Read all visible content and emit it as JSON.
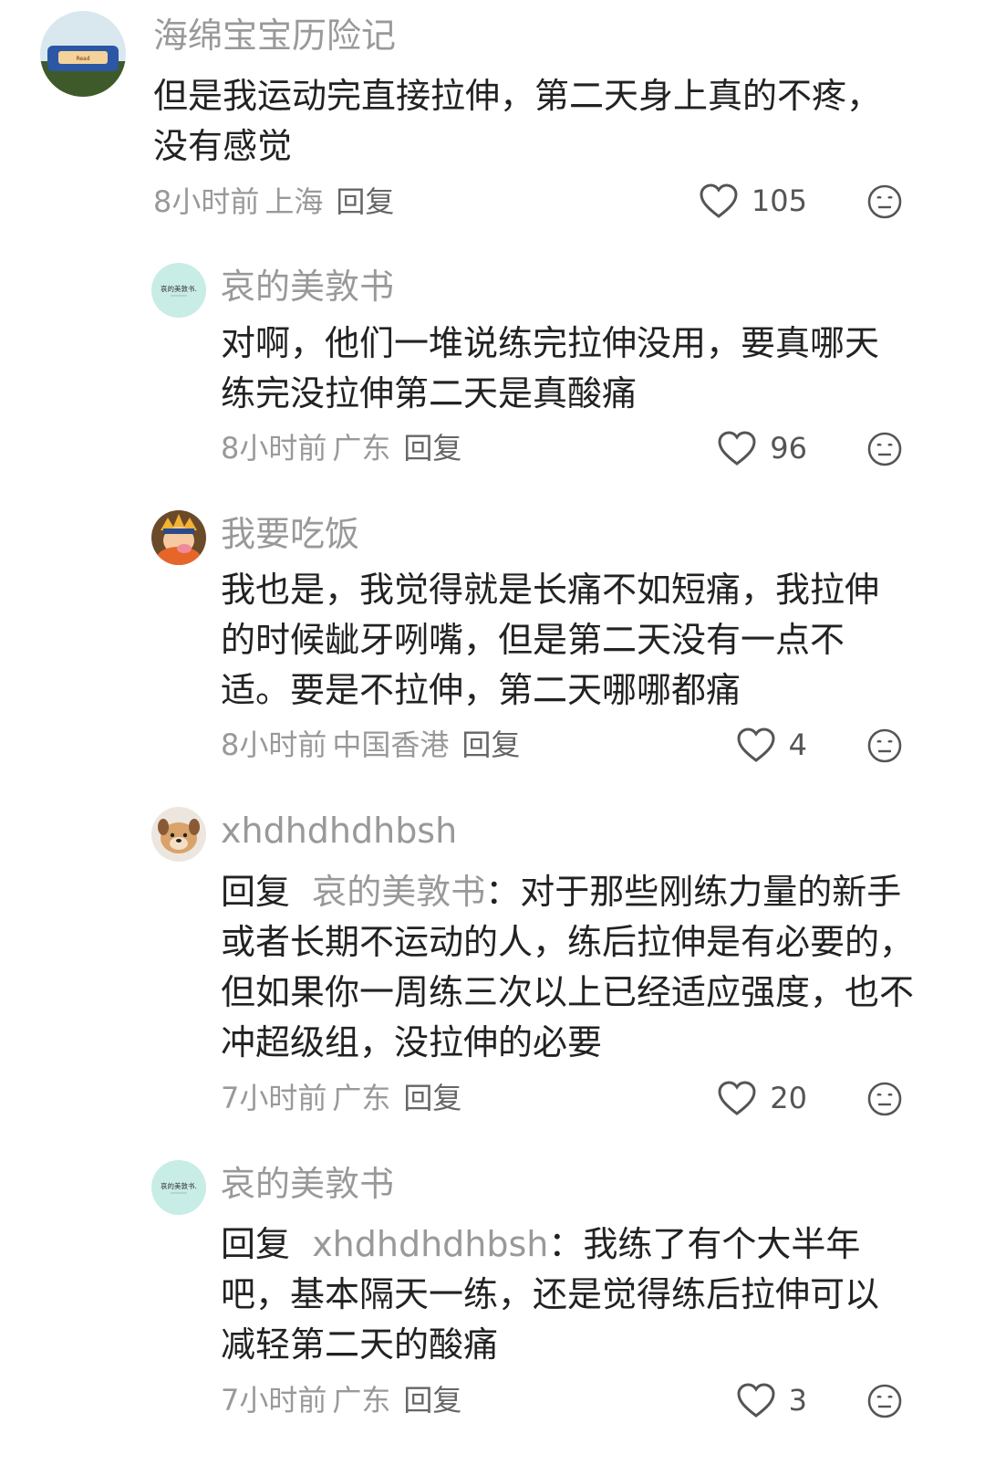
{
  "comments": [
    {
      "username": "海绵宝宝历险记",
      "avatar_icon": "spongebob-avatar-icon",
      "content": "但是我运动完直接拉伸，第二天身上真的不疼，没有感觉",
      "time": "8小时前",
      "location": "上海",
      "reply_label": "回复",
      "likes": "105"
    },
    {
      "username": "哀的美敦书",
      "avatar_icon": "text-logo-avatar-icon",
      "content": "对啊，他们一堆说练完拉伸没用，要真哪天练完没拉伸第二天是真酸痛",
      "time": "8小时前",
      "location": "广东",
      "reply_label": "回复",
      "likes": "96"
    },
    {
      "username": "我要吃饭",
      "avatar_icon": "cartoon-character-avatar-icon",
      "content": "我也是，我觉得就是长痛不如短痛，我拉伸的时候龇牙咧嘴，但是第二天没有一点不适。要是不拉伸，第二天哪哪都痛",
      "time": "8小时前",
      "location": "中国香港",
      "reply_label": "回复",
      "likes": "4"
    },
    {
      "username": "xhdhdhdhbsh",
      "avatar_icon": "dog-avatar-icon",
      "reply_prefix": "回复",
      "reply_target": "哀的美敦书",
      "content": "：对于那些刚练力量的新手或者长期不运动的人，练后拉伸是有必要的，但如果你一周练三次以上已经适应强度，也不冲超级组，没拉伸的必要",
      "time": "7小时前",
      "location": "广东",
      "reply_label": "回复",
      "likes": "20"
    },
    {
      "username": "哀的美敦书",
      "avatar_icon": "text-logo-avatar-icon",
      "reply_prefix": "回复",
      "reply_target": "xhdhdhdhbsh",
      "content": "：我练了有个大半年吧，基本隔天一练，还是觉得练后拉伸可以减轻第二天的酸痛",
      "time": "7小时前",
      "location": "广东",
      "reply_label": "回复",
      "likes": "3"
    }
  ],
  "avatar_text": {
    "logo": "哀的美敦书."
  },
  "icons": {
    "like": "heart-outline-icon",
    "reaction": "neutral-face-icon"
  }
}
